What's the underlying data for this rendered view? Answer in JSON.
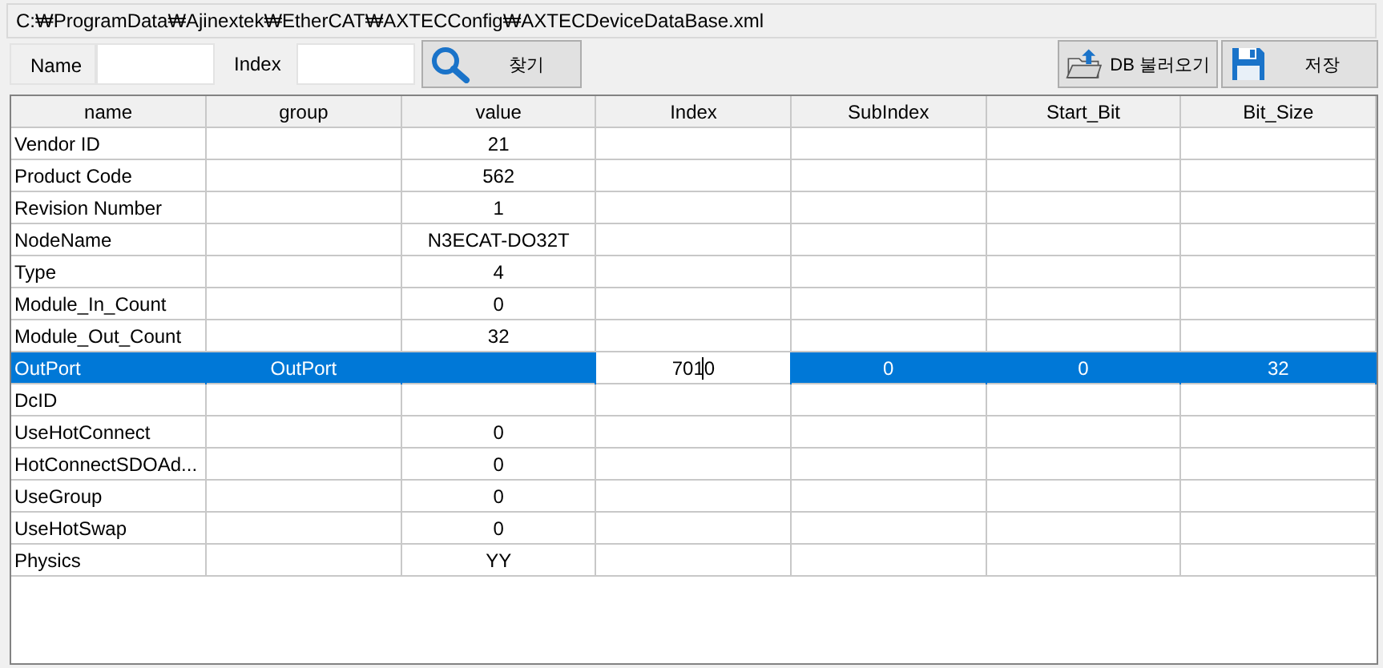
{
  "path_bar": {
    "text": "C:₩ProgramData₩Ajinextek₩EtherCAT₩AXTECConfig₩AXTECDeviceDataBase.xml"
  },
  "toolbar": {
    "name_label": "Name",
    "index_label": "Index",
    "buttons": [
      {
        "kind": "search",
        "label": "찾기"
      },
      {
        "kind": "load",
        "label": "DB 불러오기"
      },
      {
        "kind": "save",
        "label": "저장"
      }
    ]
  },
  "table": {
    "columns": [
      {
        "label": "name",
        "editing": false
      },
      {
        "label": "group",
        "editing": false
      },
      {
        "label": "value",
        "editing": false
      },
      {
        "label": "Index",
        "editing": true
      },
      {
        "label": "SubIndex",
        "editing": false
      },
      {
        "label": "Start_Bit",
        "editing": false
      },
      {
        "label": "Bit_Size",
        "editing": false
      }
    ],
    "rows": [
      {
        "cells": [
          "Vendor ID",
          null,
          "21",
          null,
          null,
          null,
          null
        ],
        "selected": false,
        "editing": false
      },
      {
        "cells": [
          "Product Code",
          null,
          "562",
          null,
          null,
          null,
          null
        ],
        "selected": false,
        "editing": false
      },
      {
        "cells": [
          "Revision Number",
          null,
          "1",
          null,
          null,
          null,
          null
        ],
        "selected": false,
        "editing": false
      },
      {
        "cells": [
          "NodeName",
          null,
          "N3ECAT-DO32T",
          null,
          null,
          null,
          null
        ],
        "selected": false,
        "editing": false
      },
      {
        "cells": [
          "Type",
          null,
          "4",
          null,
          null,
          null,
          null
        ],
        "selected": false,
        "editing": false
      },
      {
        "cells": [
          "Module_In_Count",
          null,
          "0",
          null,
          null,
          null,
          null
        ],
        "selected": false,
        "editing": false
      },
      {
        "cells": [
          "Module_Out_Count",
          null,
          "32",
          null,
          null,
          null,
          null
        ],
        "selected": false,
        "editing": false
      },
      {
        "cells": [
          "OutPort",
          "OutPort",
          null,
          "7010",
          "0",
          "0",
          "32"
        ],
        "selected": true,
        "editing": true
      },
      {
        "cells": [
          "DcID",
          null,
          null,
          null,
          null,
          null,
          null
        ],
        "selected": false,
        "editing": false
      },
      {
        "cells": [
          "UseHotConnect",
          null,
          "0",
          null,
          null,
          null,
          null
        ],
        "selected": false,
        "editing": false
      },
      {
        "cells": [
          "HotConnectSDOAd...",
          null,
          "0",
          null,
          null,
          null,
          null
        ],
        "selected": false,
        "editing": false
      },
      {
        "cells": [
          "UseGroup",
          null,
          "0",
          null,
          null,
          null,
          null
        ],
        "selected": false,
        "editing": false
      },
      {
        "cells": [
          "UseHotSwap",
          null,
          "0",
          null,
          null,
          null,
          null
        ],
        "selected": false,
        "editing": false
      },
      {
        "cells": [
          "Physics",
          null,
          "YY",
          null,
          null,
          null,
          null
        ],
        "selected": false,
        "editing": false
      }
    ]
  }
}
